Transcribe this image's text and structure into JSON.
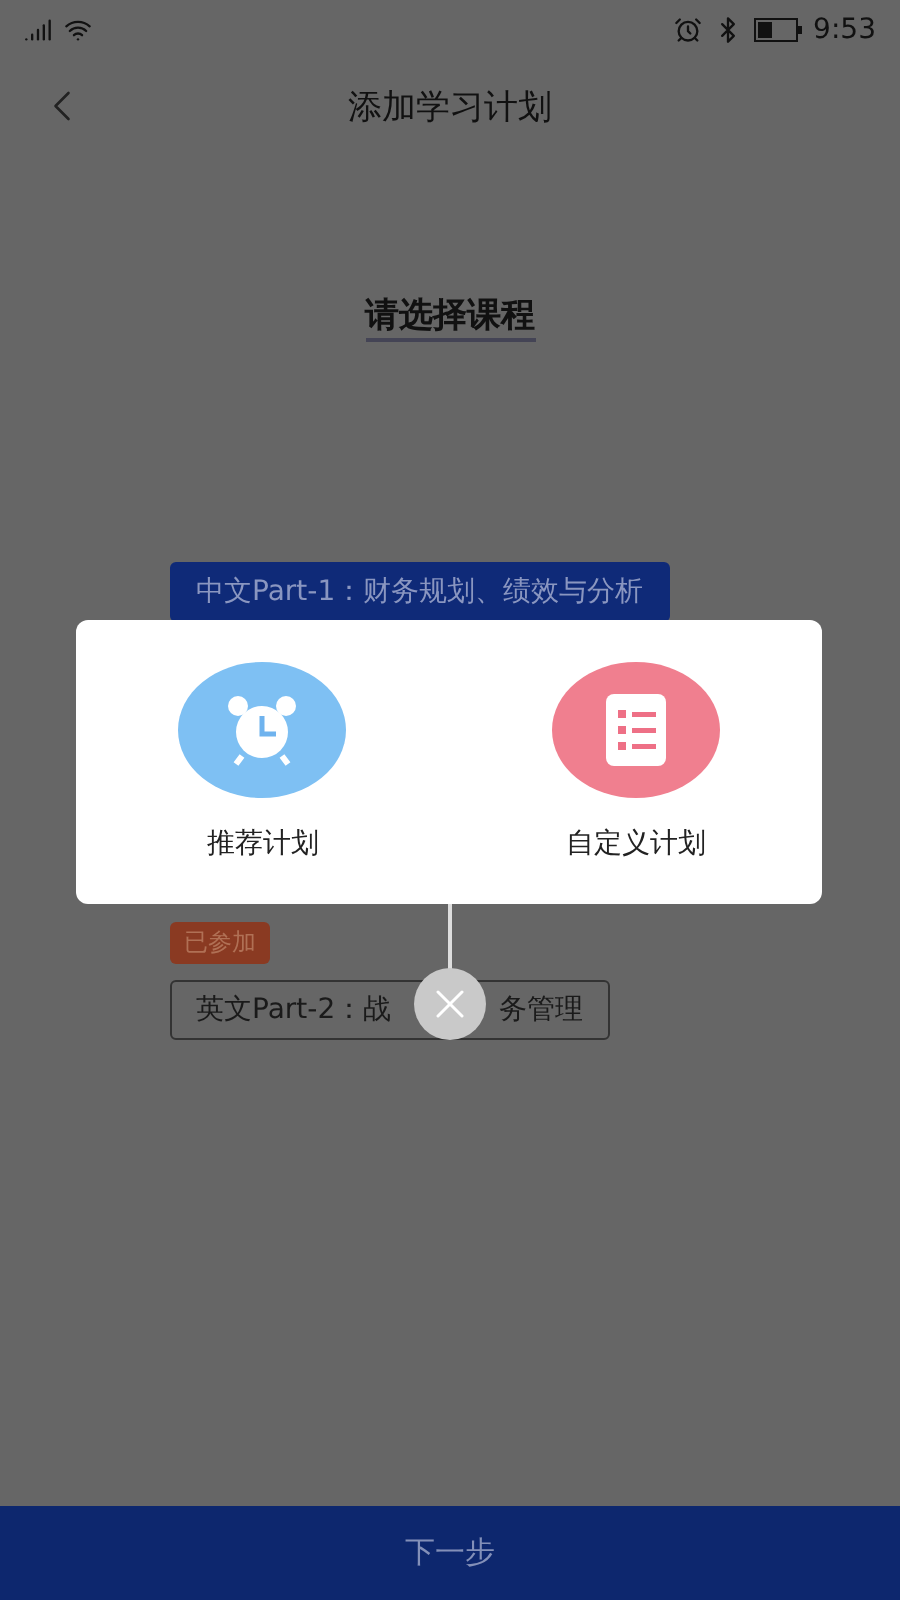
{
  "status_bar": {
    "time": "9:53"
  },
  "header": {
    "title": "添加学习计划"
  },
  "page": {
    "heading": "请选择课程"
  },
  "courses": [
    {
      "name": "中文Part-1：财务规划、绩效与分析",
      "selected": true,
      "joined": false
    },
    {
      "name_parts": [
        "英文Part-2：战",
        "务管理"
      ],
      "selected": false,
      "joined": true,
      "badge": "已参加"
    }
  ],
  "dialog": {
    "options": [
      {
        "kind": "clock",
        "label": "推荐计划"
      },
      {
        "kind": "list",
        "label": "自定义计划"
      }
    ]
  },
  "footer": {
    "button": "下一步"
  }
}
